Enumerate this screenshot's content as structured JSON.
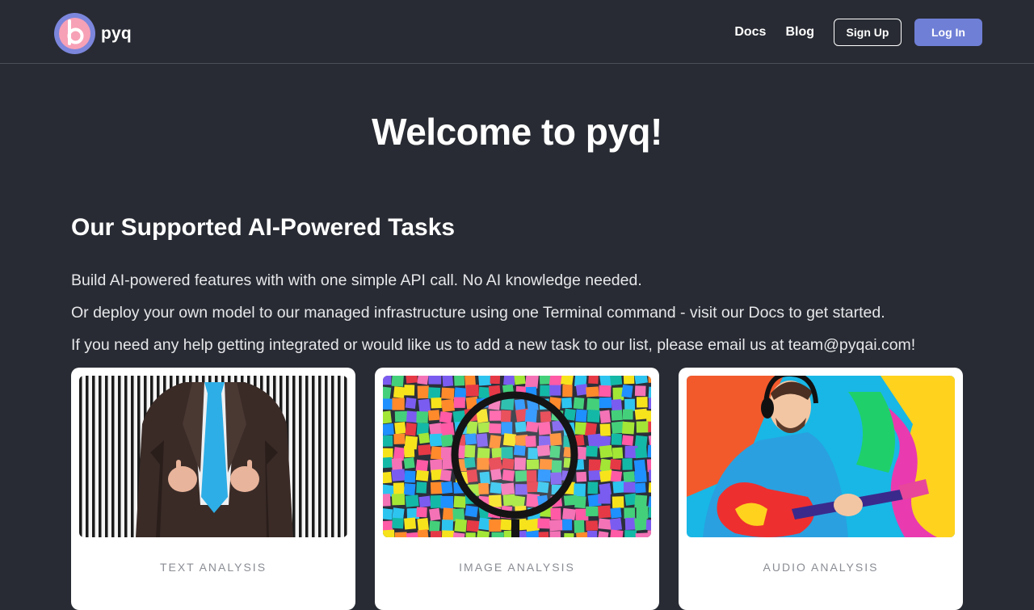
{
  "header": {
    "brand_name": "pyq",
    "logo_icon": "pyq-logo-icon",
    "nav": {
      "docs_label": "Docs",
      "blog_label": "Blog",
      "signup_label": "Sign Up",
      "login_label": "Log In"
    }
  },
  "main": {
    "welcome_title": "Welcome to pyq!",
    "section_title": "Our Supported AI-Powered Tasks",
    "description": [
      "Build AI-powered features with with one simple API call. No AI knowledge needed.",
      "Or deploy your own model to our managed infrastructure using one Terminal command - visit our Docs to get started.",
      "If you need any help getting integrated or would like us to add a new task to our list, please email us at team@pyqai.com!"
    ],
    "cards": [
      {
        "label": "TEXT ANALYSIS",
        "image": "man-in-suit-with-tie-image"
      },
      {
        "label": "IMAGE ANALYSIS",
        "image": "magnifying-glass-over-colorful-squares-image"
      },
      {
        "label": "AUDIO ANALYSIS",
        "image": "man-with-headphones-playing-guitar-image"
      }
    ]
  },
  "colors": {
    "background": "#282b33",
    "accent": "#6f7fd6",
    "logo_outer": "#7b86dc",
    "logo_inner": "#f7a1b6",
    "card_label": "#8a8d94"
  }
}
